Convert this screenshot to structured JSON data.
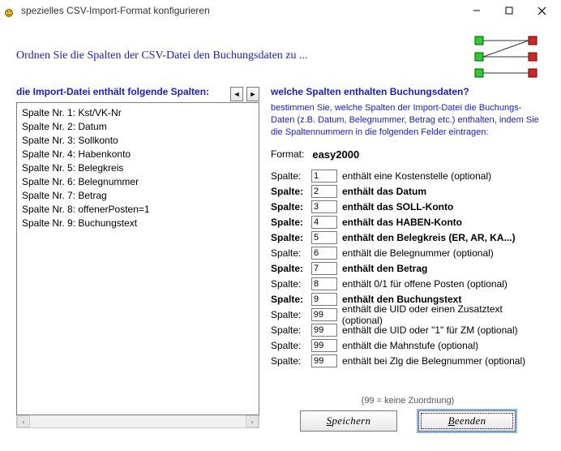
{
  "window": {
    "title": "spezielles CSV-Import-Format konfigurieren"
  },
  "header": {
    "instruction": "Ordnen Sie die Spalten der CSV-Datei den Buchungsdaten zu ..."
  },
  "left": {
    "heading": "die Import-Datei enthält folgende Spalten:",
    "items": [
      "Spalte Nr. 1: Kst/VK-Nr",
      "Spalte Nr. 2: Datum",
      "Spalte Nr. 3: Sollkonto",
      "Spalte Nr. 4: Habenkonto",
      "Spalte Nr. 5: Belegkreis",
      "Spalte Nr. 6: Belegnummer",
      "Spalte Nr. 7: Betrag",
      "Spalte Nr. 8: offenerPosten=1",
      "Spalte Nr. 9: Buchungstext"
    ]
  },
  "right": {
    "heading": "welche Spalten enthalten Buchungsdaten?",
    "explain": "bestimmen Sie, welche Spalten der Import-Datei die Buchungs-Daten (z.B. Datum, Belegnummer, Betrag etc.) enthalten, indem Sie die Spaltennummern in die folgenden Felder eintragen:",
    "format_label": "Format:",
    "format_value": "easy2000",
    "rows": [
      {
        "label": "Spalte:",
        "val": "1",
        "desc": "enthält eine Kostenstelle (optional)",
        "bold": false
      },
      {
        "label": "Spalte:",
        "val": "2",
        "desc": "enthält das Datum",
        "bold": true
      },
      {
        "label": "Spalte:",
        "val": "3",
        "desc": "enthält das SOLL-Konto",
        "bold": true
      },
      {
        "label": "Spalte:",
        "val": "4",
        "desc": "enthält das HABEN-Konto",
        "bold": true
      },
      {
        "label": "Spalte:",
        "val": "5",
        "desc": "enthält den Belegkreis (ER, AR, KA...)",
        "bold": true
      },
      {
        "label": "Spalte:",
        "val": "6",
        "desc": "enthält die Belegnummer (optional)",
        "bold": false
      },
      {
        "label": "Spalte:",
        "val": "7",
        "desc": "enthält den Betrag",
        "bold": true
      },
      {
        "label": "Spalte:",
        "val": "8",
        "desc": "enthält 0/1 für offene Posten (optional)",
        "bold": false
      },
      {
        "label": "Spalte:",
        "val": "9",
        "desc": "enthält den Buchungstext",
        "bold": true
      },
      {
        "label": "Spalte:",
        "val": "99",
        "desc": "enthält die UID oder einen Zusatztext (optional)",
        "bold": false
      },
      {
        "label": "Spalte:",
        "val": "99",
        "desc": "enthält die UID oder \"1\" für ZM (optional)",
        "bold": false
      },
      {
        "label": "Spalte:",
        "val": "99",
        "desc": "enthält die Mahnstufe (optional)",
        "bold": false
      },
      {
        "label": "Spalte:",
        "val": "99",
        "desc": "enthält bei Zlg die Belegnummer (optional)",
        "bold": false
      }
    ],
    "hint": "(99 = keine Zuordnung)"
  },
  "buttons": {
    "save_prefix": "S",
    "save_rest": "peichern",
    "close_prefix": "B",
    "close_rest": "eenden"
  }
}
